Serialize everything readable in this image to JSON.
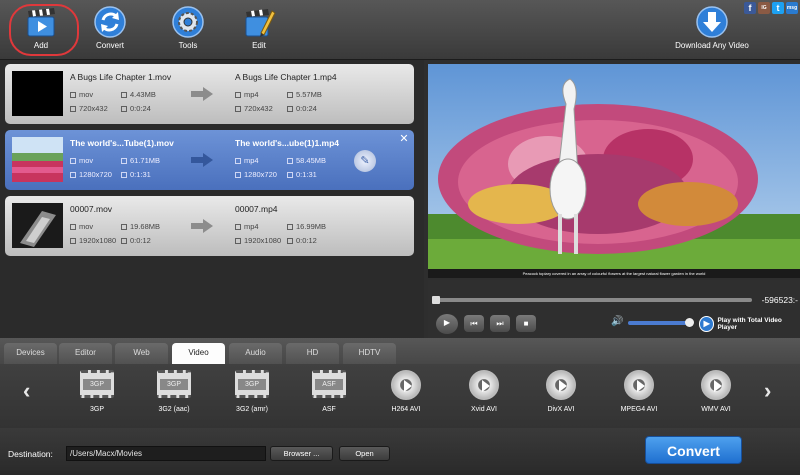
{
  "toolbar": {
    "add_label": "Add",
    "convert_label": "Convert",
    "tools_label": "Tools",
    "edit_label": "Edit",
    "download_label": "Download Any Video"
  },
  "social": [
    "f",
    "IG",
    "t",
    "msg"
  ],
  "files": [
    {
      "source_name": "A Bugs Life Chapter 1.mov",
      "source_format": "mov",
      "source_size": "4.43MB",
      "source_resolution": "720x432",
      "source_duration": "0:0:24",
      "target_name": "A Bugs Life Chapter 1.mp4",
      "target_format": "mp4",
      "target_size": "5.57MB",
      "target_resolution": "720x432",
      "target_duration": "0:0:24",
      "selected": false
    },
    {
      "source_name": "The world's...Tube(1).mov",
      "source_format": "mov",
      "source_size": "61.71MB",
      "source_resolution": "1280x720",
      "source_duration": "0:1:31",
      "target_name": "The world's...ube(1)1.mp4",
      "target_format": "mp4",
      "target_size": "58.45MB",
      "target_resolution": "1280x720",
      "target_duration": "0:1:31",
      "selected": true
    },
    {
      "source_name": "00007.mov",
      "source_format": "mov",
      "source_size": "19.68MB",
      "source_resolution": "1920x1080",
      "source_duration": "0:0:12",
      "target_name": "00007.mp4",
      "target_format": "mp4",
      "target_size": "16.99MB",
      "target_resolution": "1920x1080",
      "target_duration": "0:0:12",
      "selected": false
    }
  ],
  "preview": {
    "caption": "Peacock topiary covered in an array of colourful flowers at the largest natural flower garden in the world",
    "time": "-596523:-",
    "seek_position": 0.0,
    "volume": 1.0,
    "player_label": "Play with Total Video Player"
  },
  "tabs": [
    "Devices",
    "Editor",
    "Web",
    "Video",
    "Audio",
    "HD",
    "HDTV"
  ],
  "active_tab": "Video",
  "profiles": [
    {
      "label": "3GP",
      "icon": "film-icon",
      "badge": "3GP"
    },
    {
      "label": "3G2 (aac)",
      "icon": "film-icon",
      "badge": "3GP"
    },
    {
      "label": "3G2 (amr)",
      "icon": "film-icon",
      "badge": "3GP"
    },
    {
      "label": "ASF",
      "icon": "film-icon",
      "badge": "ASF"
    },
    {
      "label": "H264 AVI",
      "icon": "disc-play-icon"
    },
    {
      "label": "Xvid AVI",
      "icon": "disc-play-icon"
    },
    {
      "label": "DivX AVI",
      "icon": "disc-play-icon"
    },
    {
      "label": "MPEG4 AVI",
      "icon": "disc-play-icon"
    },
    {
      "label": "WMV AVI",
      "icon": "disc-play-icon"
    }
  ],
  "bottom": {
    "destination_label": "Destination:",
    "destination_path": "/Users/Macx/Movies",
    "browse_label": "Browser ...",
    "open_label": "Open",
    "convert_label": "Convert"
  },
  "colors": {
    "accent": "#2f7fd8",
    "selected_row": "#5a80c8",
    "highlight_ring": "#e0383b"
  }
}
